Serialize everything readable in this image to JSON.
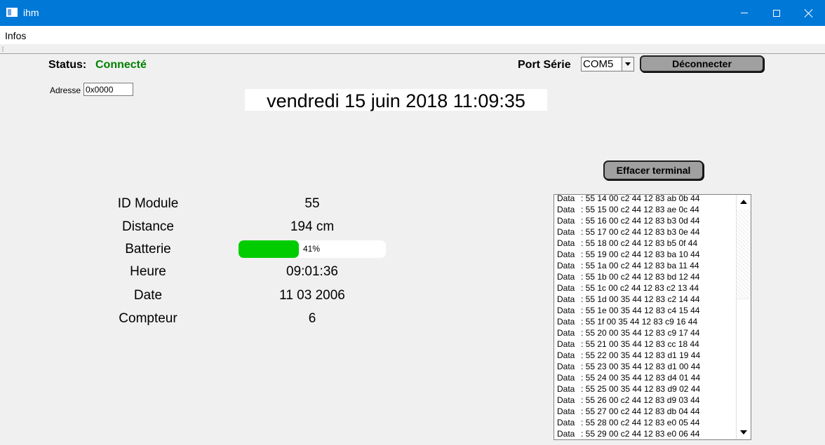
{
  "window": {
    "title": "ihm"
  },
  "menu": {
    "items": [
      "Infos"
    ]
  },
  "status": {
    "label": "Status:",
    "value": "Connecté",
    "value_color": "#008000"
  },
  "port": {
    "label": "Port Série",
    "selected": "COM5"
  },
  "buttons": {
    "disconnect": "Déconnecter",
    "clear_terminal": "Effacer terminal"
  },
  "address": {
    "label": "Adresse",
    "value": "0x0000"
  },
  "datetime": "vendredi 15 juin 2018 11:09:35",
  "module": {
    "labels": {
      "id": "ID Module",
      "distance": "Distance",
      "battery": "Batterie",
      "time": "Heure",
      "date": "Date",
      "counter": "Compteur"
    },
    "id": "55",
    "distance": "194 cm",
    "battery_percent": 41,
    "battery_text": "41%",
    "battery_color": "#00cc00",
    "time": "09:01:36",
    "date": "11 03 2006",
    "counter": "6"
  },
  "terminal": {
    "line_label": "Data",
    "lines": [
      ": 55 14 00 c2 44 12 83 ab 0b 44",
      ": 55 15 00 c2 44 12 83 ae 0c 44",
      ": 55 16 00 c2 44 12 83 b3 0d 44",
      ": 55 17 00 c2 44 12 83 b3 0e 44",
      ": 55 18 00 c2 44 12 83 b5 0f 44",
      ": 55 19 00 c2 44 12 83 ba 10 44",
      ": 55 1a 00 c2 44 12 83 ba 11 44",
      ": 55 1b 00 c2 44 12 83 bd 12 44",
      ": 55 1c 00 c2 44 12 83 c2 13 44",
      ": 55 1d 00 35 44 12 83 c2 14 44",
      ": 55 1e 00 35 44 12 83 c4 15 44",
      ": 55 1f 00 35 44 12 83 c9 16 44",
      ": 55 20 00 35 44 12 83 c9 17 44",
      ": 55 21 00 35 44 12 83 cc 18 44",
      ": 55 22 00 35 44 12 83 d1 19 44",
      ": 55 23 00 35 44 12 83 d1 00 44",
      ": 55 24 00 35 44 12 83 d4 01 44",
      ": 55 25 00 35 44 12 83 d9 02 44",
      ": 55 26 00 c2 44 12 83 d9 03 44",
      ": 55 27 00 c2 44 12 83 db 04 44",
      ": 55 28 00 c2 44 12 83 e0 05 44",
      ": 55 29 00 c2 44 12 83 e0 06 44"
    ]
  }
}
